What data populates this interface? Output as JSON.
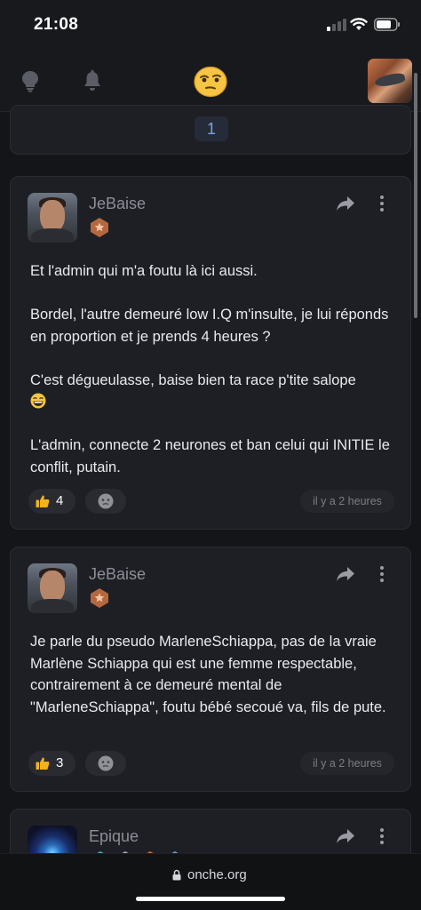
{
  "status_bar": {
    "time": "21:08"
  },
  "header": {
    "icons": [
      "lightbulb-icon",
      "bell-icon",
      "smiley-logo-icon"
    ],
    "has_avatar": true
  },
  "pagination": {
    "current_page": "1"
  },
  "posts": [
    {
      "username": "JeBaise",
      "rank_icon": "star-badge-icon",
      "paragraphs": [
        "Et l'admin qui m'a foutu là ici aussi.",
        "Bordel, l'autre demeuré low I.Q m'insulte, je lui réponds en proportion et je prends 4 heures ?",
        "C'est dégueulasse, baise bien ta race p'tite salope",
        "L'admin, connecte 2 neurones et ban celui qui INITIE le conflit, putain."
      ],
      "likes": "4",
      "time": "il y a 2 heures"
    },
    {
      "username": "JeBaise",
      "rank_icon": "star-badge-icon",
      "paragraphs": [
        "Je parle du pseudo MarleneSchiappa, pas de la vraie Marlène Schiappa qui est une femme respectable, contrairement à ce demeuré mental de \"MarleneSchiappa\", foutu bébé secoué va, fils de pute."
      ],
      "likes": "3",
      "time": "il y a 2 heures"
    },
    {
      "username": "Epique"
    }
  ],
  "browser": {
    "url": "onche.org"
  },
  "colors": {
    "background": "#141518",
    "card": "#1e1f24",
    "page_link": "#7aa3dc",
    "username": "#8b8e97",
    "badge_bronze": "#b5683f"
  }
}
